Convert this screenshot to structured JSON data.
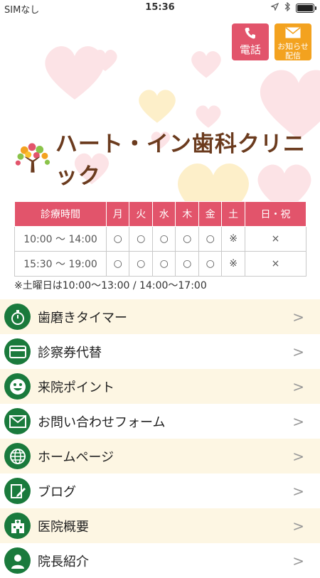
{
  "status": {
    "carrier": "SIMなし",
    "time": "15:36"
  },
  "buttons": {
    "tel_label": "電話",
    "news_label_1": "お知らせ",
    "news_label_2": "配信"
  },
  "logo_text": "ハート・イン歯科クリニック",
  "schedule": {
    "headers": [
      "診療時間",
      "月",
      "火",
      "水",
      "木",
      "金",
      "土",
      "日・祝"
    ],
    "rows": [
      [
        "10:00 ～ 14:00",
        "○",
        "○",
        "○",
        "○",
        "○",
        "※",
        "×"
      ],
      [
        "15:30 ～ 19:00",
        "○",
        "○",
        "○",
        "○",
        "○",
        "※",
        "×"
      ]
    ],
    "note": "※土曜日は10:00～13:00 / 14:00～17:00"
  },
  "menu": [
    {
      "label": "歯磨きタイマー",
      "icon": "stopwatch-icon"
    },
    {
      "label": "診察券代替",
      "icon": "card-icon"
    },
    {
      "label": "来院ポイント",
      "icon": "smile-icon"
    },
    {
      "label": "お問い合わせフォーム",
      "icon": "mail-icon"
    },
    {
      "label": "ホームページ",
      "icon": "globe-icon"
    },
    {
      "label": "ブログ",
      "icon": "blog-icon"
    },
    {
      "label": "医院概要",
      "icon": "building-icon"
    },
    {
      "label": "院長紹介",
      "icon": "person-icon"
    }
  ],
  "chevron": ">",
  "colors": {
    "accent_pink": "#e2546b",
    "accent_orange": "#f3a21f",
    "menu_green": "#1a7a3c",
    "brand_brown": "#6b3b1e"
  }
}
